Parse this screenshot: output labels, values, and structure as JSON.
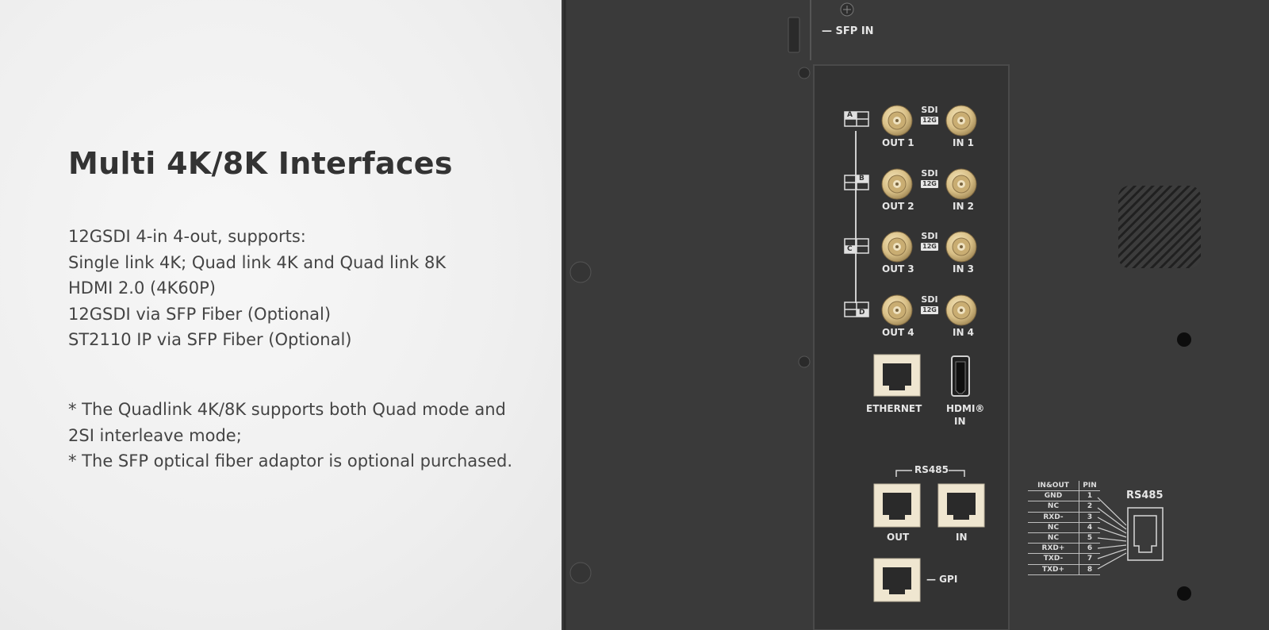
{
  "left": {
    "title": "Multi 4K/8K Interfaces",
    "features": [
      "12GSDI 4-in 4-out, supports:",
      "Single link 4K; Quad link 4K and Quad link 8K",
      "HDMI 2.0 (4K60P)",
      "12GSDI via SFP Fiber (Optional)",
      "ST2110 IP via SFP Fiber (Optional)"
    ],
    "notes": [
      "* The Quadlink 4K/8K supports both Quad mode and",
      "2SI interleave mode;",
      "* The SFP optical fiber adaptor is optional purchased."
    ]
  },
  "panel": {
    "sfp_label": "— SFP IN",
    "sdi_label": "SDI",
    "sdi_badge": "12G",
    "sdi_ports": [
      {
        "out": "OUT 1",
        "in": "IN 1",
        "quad": "A"
      },
      {
        "out": "OUT 2",
        "in": "IN 2",
        "quad": "B"
      },
      {
        "out": "OUT 3",
        "in": "IN 3",
        "quad": "C"
      },
      {
        "out": "OUT 4",
        "in": "IN 4",
        "quad": "D"
      }
    ],
    "ethernet_label": "ETHERNET",
    "hdmi_label_line1": "HDMI®",
    "hdmi_label_line2": "IN",
    "rs485_label": "RS485",
    "rs485_out": "OUT",
    "rs485_in": "IN",
    "gpi_label": "— GPI",
    "pinout": {
      "title": "RS485",
      "header": {
        "signal": "IN&OUT",
        "pin": "PIN"
      },
      "rows": [
        {
          "signal": "GND",
          "pin": "1"
        },
        {
          "signal": "NC",
          "pin": "2"
        },
        {
          "signal": "RXD-",
          "pin": "3"
        },
        {
          "signal": "NC",
          "pin": "4"
        },
        {
          "signal": "NC",
          "pin": "5"
        },
        {
          "signal": "RXD+",
          "pin": "6"
        },
        {
          "signal": "TXD-",
          "pin": "7"
        },
        {
          "signal": "TXD+",
          "pin": "8"
        }
      ]
    }
  },
  "colors": {
    "panel": "#3a3a3a",
    "inner_panel": "#333333",
    "bnc_gold": "#d8bf86",
    "rj45_cream": "#efe6d0"
  }
}
